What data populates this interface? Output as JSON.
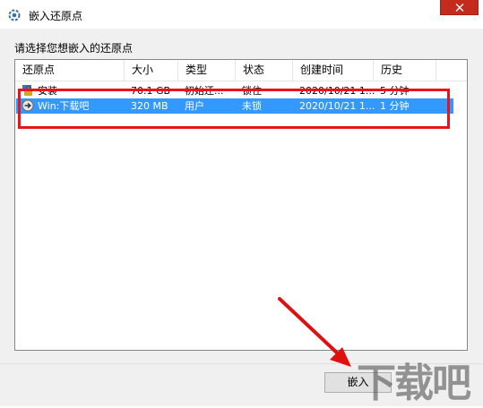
{
  "window": {
    "title": "嵌入还原点",
    "icon": "gear-icon",
    "close_icon": "close-icon"
  },
  "dialog": {
    "prompt": "请选择您想嵌入的还原点",
    "columns": [
      "还原点",
      "大小",
      "类型",
      "状态",
      "创建时间",
      "历史"
    ],
    "rows": [
      {
        "name": "安装",
        "size": "70.1 GB",
        "type": "初始还...",
        "status": "锁住",
        "created": "2020/10/21 1...",
        "history": "5 分钟",
        "icon": "lock-icon",
        "selected": false
      },
      {
        "name": "Win:下载吧",
        "size": "320 MB",
        "type": "用户",
        "status": "未锁",
        "created": "2020/10/21 1...",
        "history": "1 分钟",
        "icon": "restore-arrow-icon",
        "selected": true
      }
    ],
    "embed_button_label": "嵌入"
  },
  "watermark": "下载吧",
  "colors": {
    "selection": "#3399ff",
    "highlight_box": "#e8141c",
    "arrow": "#e01010",
    "close_button": "#c42b1c"
  }
}
